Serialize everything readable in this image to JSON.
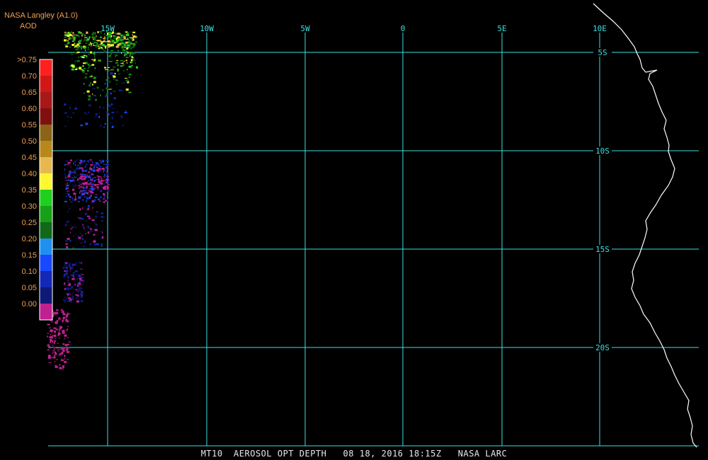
{
  "header": {
    "source": "NASA Langley (A1.0)",
    "product": "AOD"
  },
  "legend": {
    "labels": [
      ">0.75",
      "0.70",
      "0.65",
      "0.60",
      "0.55",
      "0.50",
      "0.45",
      "0.40",
      "0.35",
      "0.30",
      "0.25",
      "0.20",
      "0.15",
      "0.10",
      "0.05",
      "0.00"
    ],
    "colors": [
      "#ff2020",
      "#d01818",
      "#a81818",
      "#801010",
      "#8c6418",
      "#b8881c",
      "#e8b850",
      "#fff830",
      "#20d020",
      "#18a018",
      "#106818",
      "#2090f0",
      "#1848ff",
      "#1428b8",
      "#101878",
      "#c02090"
    ]
  },
  "grid": {
    "longitudes": [
      "15W",
      "10W",
      "5W",
      "0",
      "5E",
      "10E"
    ],
    "latitudes": [
      "5S",
      "10S",
      "15S",
      "20S"
    ],
    "line_color": "#3ee0e0"
  },
  "footer": {
    "text": "MT10  AEROSOL OPT DEPTH   08 18, 2016 18:15Z   NASA LARC"
  },
  "colors": {
    "background": "#000000",
    "header_text": "#f0a050",
    "coastline": "#ffffff",
    "footer_text": "#e8e8e8"
  }
}
